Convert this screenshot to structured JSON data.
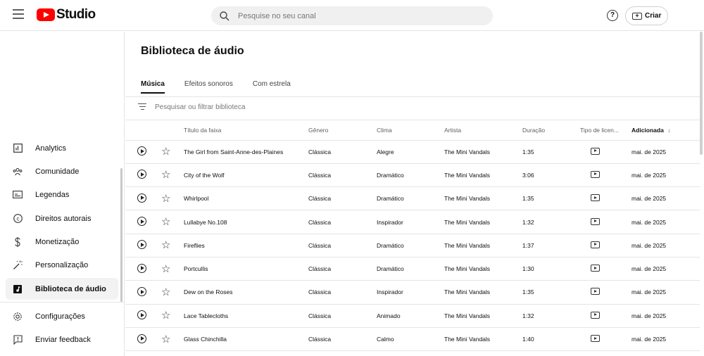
{
  "header": {
    "logo_text": "Studio",
    "search_placeholder": "Pesquise no seu canal",
    "help_icon": "?",
    "create_label": "Criar"
  },
  "sidebar": {
    "items": [
      {
        "label": "Analytics",
        "icon": "analytics-icon"
      },
      {
        "label": "Comunidade",
        "icon": "community-icon"
      },
      {
        "label": "Legendas",
        "icon": "subtitles-icon"
      },
      {
        "label": "Direitos autorais",
        "icon": "copyright-icon"
      },
      {
        "label": "Monetização",
        "icon": "monetization-icon"
      },
      {
        "label": "Personalização",
        "icon": "customization-icon"
      },
      {
        "label": "Biblioteca de áudio",
        "icon": "audio-library-icon",
        "active": true
      }
    ],
    "bottom_items": [
      {
        "label": "Configurações",
        "icon": "settings-icon"
      },
      {
        "label": "Enviar feedback",
        "icon": "feedback-icon"
      }
    ]
  },
  "main": {
    "title": "Biblioteca de áudio",
    "tabs": [
      {
        "label": "Música",
        "active": true
      },
      {
        "label": "Efeitos sonoros"
      },
      {
        "label": "Com estrela"
      }
    ],
    "filter_placeholder": "Pesquisar ou filtrar biblioteca",
    "columns": {
      "title": "Título da faixa",
      "genre": "Gênero",
      "mood": "Clima",
      "artist": "Artista",
      "duration": "Duração",
      "license": "Tipo de licen...",
      "added": "Adicionada",
      "sort_arrow": "↓"
    },
    "rows": [
      {
        "title": "The Girl from Saint-Anne-des-Plaines",
        "genre": "Clássica",
        "mood": "Alegre",
        "artist": "The Mini Vandals",
        "duration": "1:35",
        "added": "mai. de 2025"
      },
      {
        "title": "City of the Wolf",
        "genre": "Clássica",
        "mood": "Dramático",
        "artist": "The Mini Vandals",
        "duration": "3:06",
        "added": "mai. de 2025"
      },
      {
        "title": "Whirlpool",
        "genre": "Clássica",
        "mood": "Dramático",
        "artist": "The Mini Vandals",
        "duration": "1:35",
        "added": "mai. de 2025"
      },
      {
        "title": "Lullabye No.108",
        "genre": "Clássica",
        "mood": "Inspirador",
        "artist": "The Mini Vandals",
        "duration": "1:32",
        "added": "mai. de 2025"
      },
      {
        "title": "Fireflies",
        "genre": "Clássica",
        "mood": "Dramático",
        "artist": "The Mini Vandals",
        "duration": "1:37",
        "added": "mai. de 2025"
      },
      {
        "title": "Portcullis",
        "genre": "Clássica",
        "mood": "Dramático",
        "artist": "The Mini Vandals",
        "duration": "1:30",
        "added": "mai. de 2025"
      },
      {
        "title": "Dew on the Roses",
        "genre": "Clássica",
        "mood": "Inspirador",
        "artist": "The Mini Vandals",
        "duration": "1:35",
        "added": "mai. de 2025"
      },
      {
        "title": "Lace Tablecloths",
        "genre": "Clássica",
        "mood": "Animado",
        "artist": "The Mini Vandals",
        "duration": "1:32",
        "added": "mai. de 2025"
      },
      {
        "title": "Glass Chinchilla",
        "genre": "Clássica",
        "mood": "Calmo",
        "artist": "The Mini Vandals",
        "duration": "1:40",
        "added": "mai. de 2025"
      }
    ]
  }
}
